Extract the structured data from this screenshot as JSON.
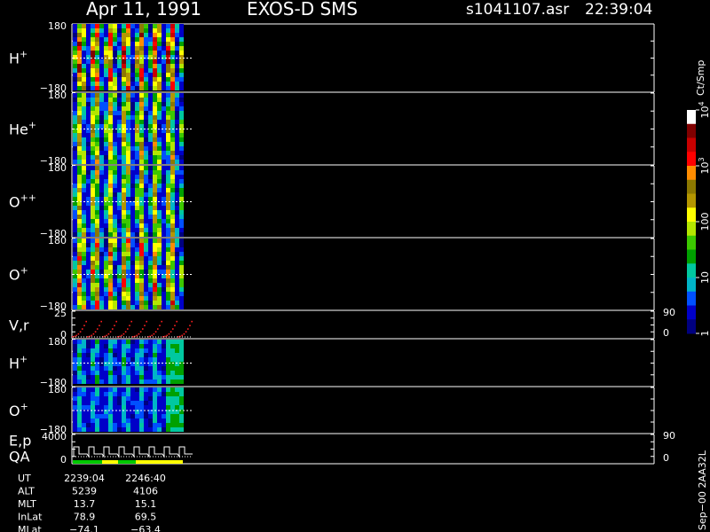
{
  "header": {
    "date": "Apr 11, 1991",
    "instrument": "EXOS-D SMS",
    "file": "s1041107.asr",
    "time": "22:39:04"
  },
  "colorbar": {
    "unit": "Ct/Smp",
    "ticks": [
      {
        "label": "1",
        "value": 1
      },
      {
        "label": "10",
        "value": 10
      },
      {
        "label": "100",
        "value": 100
      },
      {
        "label": "10",
        "sup": "3",
        "value": 1000
      },
      {
        "label": "10",
        "sup": "4",
        "value": 10000
      }
    ],
    "colors": [
      "#000080",
      "#0000c8",
      "#0050ff",
      "#00b4c8",
      "#00c8a0",
      "#00a000",
      "#3cc800",
      "#b4e600",
      "#ffff00",
      "#b49600",
      "#8c7800",
      "#ff8c00",
      "#ff0000",
      "#c80000",
      "#800000",
      "#ffffff"
    ]
  },
  "chart_data": {
    "type": "heatmap",
    "panels": [
      {
        "id": "h-plus-1",
        "ion": "H",
        "charge": "+",
        "ymax": "180",
        "ymin": "−180",
        "intensity": 1.0
      },
      {
        "id": "he-plus",
        "ion": "He",
        "charge": "+",
        "ymax": "180",
        "ymin": "−180",
        "intensity": 0.75
      },
      {
        "id": "o-pp",
        "ion": "O",
        "charge": "++",
        "ymax": "180",
        "ymin": "−180",
        "intensity": 0.7
      },
      {
        "id": "o-plus-1",
        "ion": "O",
        "charge": "+",
        "ymax": "180",
        "ymin": "−180",
        "intensity": 0.85
      },
      {
        "id": "vr",
        "ion": "V,r",
        "charge": "",
        "ymax": "25",
        "ymin": "0",
        "right_top": "90",
        "right_bottom": "0"
      },
      {
        "id": "h-plus-2",
        "ion": "H",
        "charge": "+",
        "ymax": "180",
        "ymin": "−180",
        "intensity": 0.35
      },
      {
        "id": "o-plus-2",
        "ion": "O",
        "charge": "+",
        "ymax": "180",
        "ymin": "−180",
        "intensity": 0.3
      },
      {
        "id": "ep",
        "ion": "E,p",
        "ion2": "QA",
        "charge": "",
        "ymax": "4000",
        "ymin": "0",
        "right_top": "90",
        "right_bottom": "0"
      }
    ]
  },
  "ephemeris": {
    "rows": [
      {
        "label": "UT",
        "v1": "2239:04",
        "v2": "2246:40"
      },
      {
        "label": "ALT",
        "v1": "5239",
        "v2": "4106"
      },
      {
        "label": "MLT",
        "v1": "13.7",
        "v2": "15.1"
      },
      {
        "label": "InLat",
        "v1": "78.9",
        "v2": "69.5"
      },
      {
        "label": "MLat",
        "v1": "−74.1",
        "v2": "−63.4"
      }
    ]
  },
  "footer_vertical": "Sep−00 2AA32L"
}
